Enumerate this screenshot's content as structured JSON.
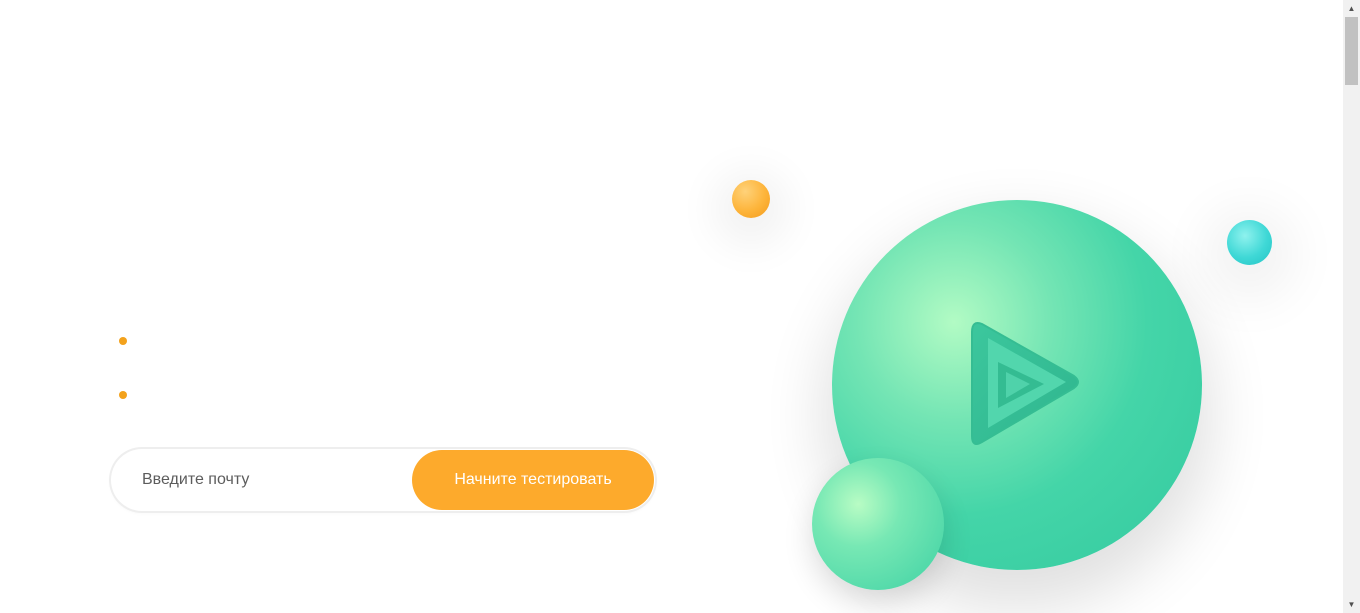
{
  "hero": {
    "bullets": [
      "",
      ""
    ],
    "email_placeholder": "Введите почту",
    "cta_label": "Начните тестировать"
  },
  "decor": {
    "play_icon": "play-icon",
    "colors": {
      "accent_orange": "#fdaa2c",
      "accent_green": "#44d5a8",
      "accent_teal": "#3fd8d6"
    }
  },
  "scrollbar": {
    "up_icon": "scroll-up-arrow-icon",
    "down_icon": "scroll-down-arrow-icon",
    "up_glyph": "▲",
    "down_glyph": "▼"
  }
}
